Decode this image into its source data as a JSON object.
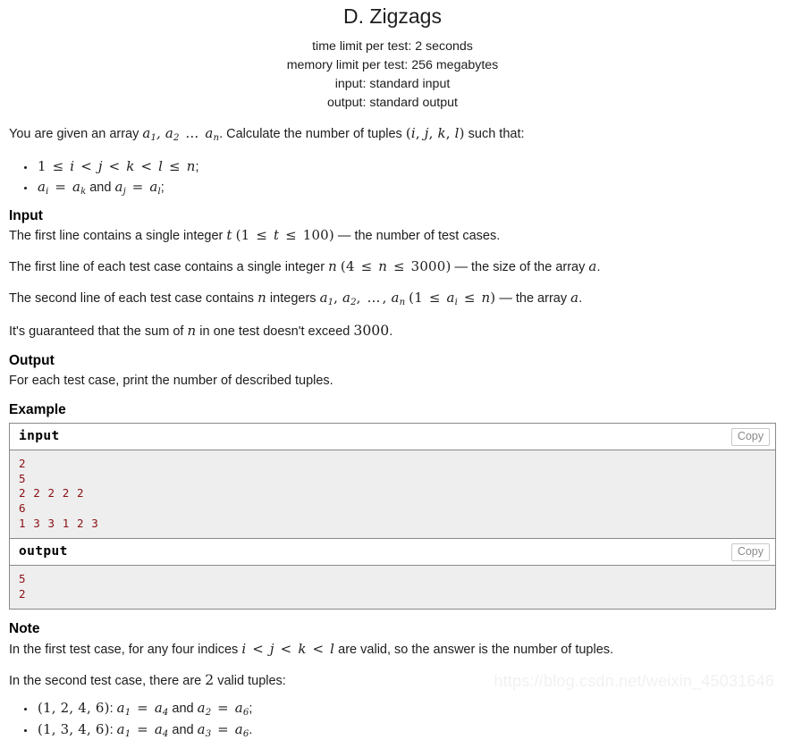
{
  "header": {
    "title": "D. Zigzags",
    "limits": [
      "time limit per test: 2 seconds",
      "memory limit per test: 256 megabytes",
      "input: standard input",
      "output: standard output"
    ]
  },
  "statement": {
    "intro_1": "You are given an array ",
    "intro_math": "a₁, a₂ … aₙ",
    "intro_2": ". Calculate the number of tuples ",
    "intro_tuple": "(i, j, k, l)",
    "intro_3": " such that:",
    "bullets": [
      "1 ≤ i < j < k < l ≤ n;",
      "aᵢ = aₖ and aⱼ = aₗ;"
    ]
  },
  "input_section": {
    "heading": "Input",
    "p1_a": "The first line contains a single integer ",
    "p1_var": "t",
    "p1_range": "(1 ≤ t ≤ 100)",
    "p1_b": " — the number of test cases.",
    "p2_a": "The first line of each test case contains a single integer ",
    "p2_var": "n",
    "p2_range": "(4 ≤ n ≤ 3000)",
    "p2_b": " — the size of the array ",
    "p2_var2": "a",
    "p2_c": ".",
    "p3_a": "The second line of each test case contains ",
    "p3_var": "n",
    "p3_b": " integers ",
    "p3_list": "a₁, a₂, …, aₙ",
    "p3_range": "(1 ≤ aᵢ ≤ n)",
    "p3_c": " — the array ",
    "p3_var2": "a",
    "p3_d": ".",
    "p4_a": "It's guaranteed that the sum of ",
    "p4_var": "n",
    "p4_b": " in one test doesn't exceed ",
    "p4_num": "3000",
    "p4_c": "."
  },
  "output_section": {
    "heading": "Output",
    "text": "For each test case, print the number of described tuples."
  },
  "example_section": {
    "heading": "Example",
    "samples": [
      {
        "label": "input",
        "copy_label": "Copy",
        "data": "2\n5\n2 2 2 2 2\n6\n1 3 3 1 2 3"
      },
      {
        "label": "output",
        "copy_label": "Copy",
        "data": "5\n2"
      }
    ]
  },
  "note_section": {
    "heading": "Note",
    "p1_a": "In the first test case, for any four indices ",
    "p1_math": "i < j < k < l",
    "p1_b": " are valid, so the answer is the number of tuples.",
    "p2_a": "In the second test case, there are ",
    "p2_num": "2",
    "p2_b": " valid tuples:",
    "bullets": [
      {
        "tuple": "(1, 2, 4, 6)",
        "sep": ": ",
        "eq1": "a₁ = a₄",
        "and": " and ",
        "eq2": "a₂ = a₆",
        "end": ";"
      },
      {
        "tuple": "(1, 3, 4, 6)",
        "sep": ": ",
        "eq1": "a₁ = a₄",
        "and": " and ",
        "eq2": "a₃ = a₆",
        "end": "."
      }
    ]
  },
  "watermark": {
    "text": "https://blog.csdn.net/weixin_45031646"
  }
}
